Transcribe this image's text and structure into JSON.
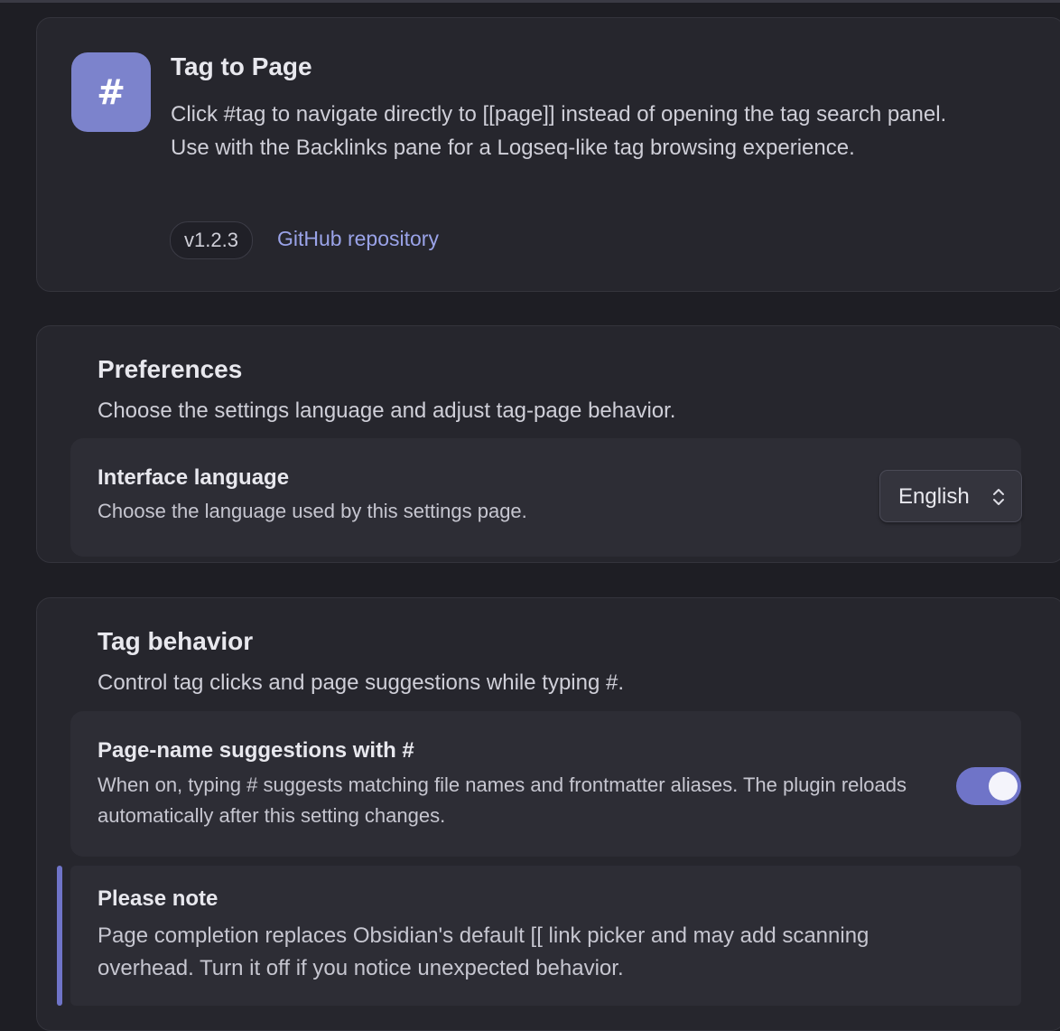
{
  "plugin": {
    "icon_glyph": "#",
    "title": "Tag to Page",
    "description": "Click #tag to navigate directly to [[page]] instead of opening the tag search panel. Use with the Backlinks pane for a Logseq-like tag browsing experience.",
    "version": "v1.2.3",
    "repo_link_label": "GitHub repository"
  },
  "preferences": {
    "title": "Preferences",
    "description": "Choose the settings language and adjust tag-page behavior.",
    "interface_language": {
      "name": "Interface language",
      "description": "Choose the language used by this settings page.",
      "selected": "English"
    }
  },
  "tag_behavior": {
    "title": "Tag behavior",
    "description": "Control tag clicks and page suggestions while typing #.",
    "page_suggestions": {
      "name": "Page-name suggestions with #",
      "description": "When on, typing # suggests matching file names and frontmatter aliases. The plugin reloads automatically after this setting changes.",
      "enabled": true
    },
    "note": {
      "title": "Please note",
      "text": "Page completion replaces Obsidian's default [[ link picker and may add scanning overhead. Turn it off if you notice unexpected behavior."
    }
  },
  "colors": {
    "accent": "#7c83cc",
    "link": "#9aa3e8",
    "background": "#1e1e24",
    "card": "#26262d"
  },
  "icons": {
    "dropdown": "chevron-up-down-icon"
  }
}
